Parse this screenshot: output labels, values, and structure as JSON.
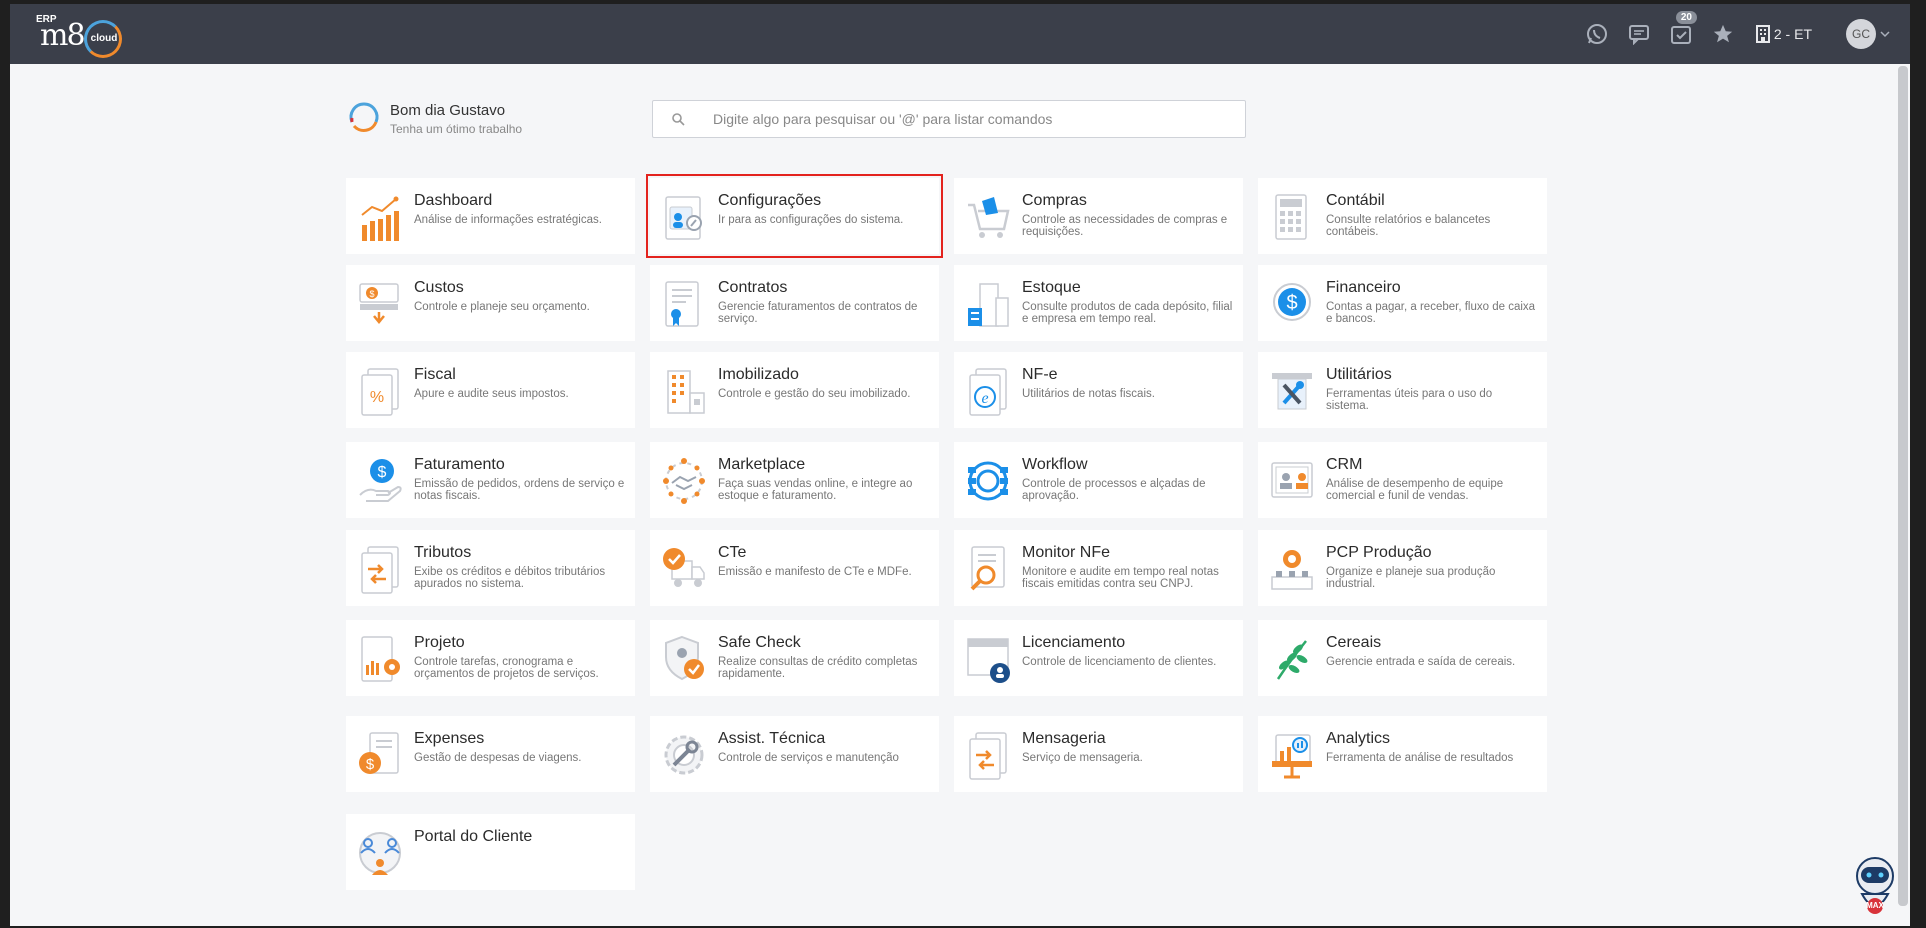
{
  "topbar": {
    "logo": {
      "erp": "ERP",
      "mark": "m8",
      "cloud": "cloud"
    },
    "icons": [
      "whatsapp-icon",
      "chat-icon",
      "tasks-icon",
      "star-icon",
      "building-icon"
    ],
    "tasks_badge": "20",
    "company": "2 - ET",
    "user_initials": "GC"
  },
  "greeting": {
    "title": "Bom dia Gustavo",
    "subtitle": "Tenha um ótimo trabalho"
  },
  "search": {
    "placeholder": "Digite algo para pesquisar ou '@' para listar comandos",
    "value": ""
  },
  "modules": [
    {
      "title": "Dashboard",
      "desc": "Análise de informações estratégicas.",
      "icon": "chart-icon",
      "selected": false
    },
    {
      "title": "Configurações",
      "desc": "Ir para as configurações do sistema.",
      "icon": "settings-icon",
      "selected": true
    },
    {
      "title": "Compras",
      "desc": "Controle as necessidades de compras e requisições.",
      "icon": "cart-icon",
      "selected": false
    },
    {
      "title": "Contábil",
      "desc": "Consulte relatórios e balancetes contábeis.",
      "icon": "calculator-icon",
      "selected": false
    },
    {
      "title": "Custos",
      "desc": "Controle e planeje seu orçamento.",
      "icon": "money-icon",
      "selected": false
    },
    {
      "title": "Contratos",
      "desc": "Gerencie faturamentos de contratos de serviço.",
      "icon": "contract-icon",
      "selected": false
    },
    {
      "title": "Estoque",
      "desc": "Consulte produtos de cada depósito, filial e empresa em tempo real.",
      "icon": "warehouse-icon",
      "selected": false
    },
    {
      "title": "Financeiro",
      "desc": "Contas a pagar, a receber, fluxo de caixa e bancos.",
      "icon": "dollar-icon",
      "selected": false
    },
    {
      "title": "Fiscal",
      "desc": "Apure e audite seus impostos.",
      "icon": "percent-icon",
      "selected": false
    },
    {
      "title": "Imobilizado",
      "desc": "Controle e gestão do seu imobilizado.",
      "icon": "buildings-icon",
      "selected": false
    },
    {
      "title": "NF-e",
      "desc": "Utilitários de notas fiscais.",
      "icon": "nfe-icon",
      "selected": false
    },
    {
      "title": "Utilitários",
      "desc": "Ferramentas úteis para o uso do sistema.",
      "icon": "tools-icon",
      "selected": false
    },
    {
      "title": "Faturamento",
      "desc": "Emissão de pedidos, ordens de serviço e notas fiscais.",
      "icon": "billing-icon",
      "selected": false
    },
    {
      "title": "Marketplace",
      "desc": "Faça suas vendas online, e integre ao estoque e faturamento.",
      "icon": "handshake-icon",
      "selected": false
    },
    {
      "title": "Workflow",
      "desc": "Controle de processos e alçadas de aprovação.",
      "icon": "workflow-icon",
      "selected": false
    },
    {
      "title": "CRM",
      "desc": "Análise de desempenho de equipe comercial e funil de vendas.",
      "icon": "crm-icon",
      "selected": false
    },
    {
      "title": "Tributos",
      "desc": "Exibe os créditos e débitos tributários apurados no sistema.",
      "icon": "taxes-icon",
      "selected": false
    },
    {
      "title": "CTe",
      "desc": "Emissão e manifesto de CTe e MDFe.",
      "icon": "truck-icon",
      "selected": false
    },
    {
      "title": "Monitor NFe",
      "desc": "Monitore e audite em tempo real notas fiscais emitidas contra seu CNPJ.",
      "icon": "magnifier-icon",
      "selected": false
    },
    {
      "title": "PCP Produção",
      "desc": "Organize e planeje sua produção industrial.",
      "icon": "production-icon",
      "selected": false
    },
    {
      "title": "Projeto",
      "desc": "Controle tarefas, cronograma e orçamentos de projetos de serviços.",
      "icon": "project-icon",
      "selected": false
    },
    {
      "title": "Safe Check",
      "desc": "Realize consultas de crédito completas rapidamente.",
      "icon": "shield-icon",
      "selected": false
    },
    {
      "title": "Licenciamento",
      "desc": "Controle de licenciamento de clientes.",
      "icon": "license-icon",
      "selected": false
    },
    {
      "title": "Cereais",
      "desc": "Gerencie entrada e saída de cereais.",
      "icon": "plant-icon",
      "selected": false
    },
    {
      "title": "Expenses",
      "desc": "Gestão de despesas de viagens.",
      "icon": "expenses-icon",
      "selected": false
    },
    {
      "title": "Assist. Técnica",
      "desc": "Controle de serviços e manutenção",
      "icon": "wrench-gear-icon",
      "selected": false
    },
    {
      "title": "Mensageria",
      "desc": "Serviço de mensageria.",
      "icon": "messaging-icon",
      "selected": false
    },
    {
      "title": "Analytics",
      "desc": "Ferramenta de análise de resultados",
      "icon": "analytics-icon",
      "selected": false
    },
    {
      "title": "Portal do Cliente",
      "desc": "",
      "icon": "users-icon",
      "selected": false
    }
  ],
  "assistant": {
    "name": "MAX"
  },
  "colors": {
    "topbar": "#3b3f4a",
    "accent_orange": "#f08a2c",
    "accent_blue": "#1b8fe8",
    "selected_outline": "#e3231e"
  }
}
